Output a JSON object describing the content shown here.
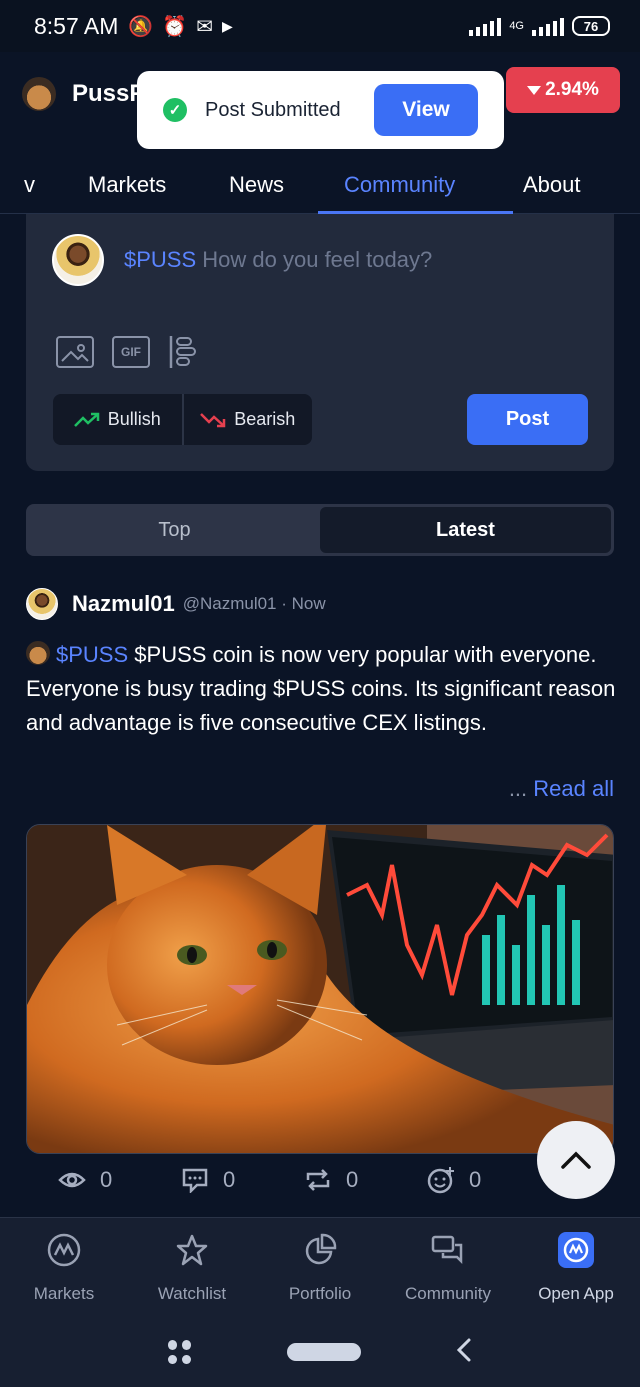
{
  "status_bar": {
    "time": "8:57 AM",
    "network": "4G",
    "battery": "76"
  },
  "header": {
    "brand": "PussF",
    "price_change": "2.94%"
  },
  "toast": {
    "message": "Post Submitted",
    "action": "View"
  },
  "tabs": [
    {
      "label": "v"
    },
    {
      "label": "Markets"
    },
    {
      "label": "News"
    },
    {
      "label": "Community"
    },
    {
      "label": "About"
    }
  ],
  "composer": {
    "ticker": "$PUSS",
    "placeholder": "How do you feel today?",
    "gif_label": "GIF",
    "bullish": "Bullish",
    "bearish": "Bearish",
    "post": "Post"
  },
  "feed_toggle": {
    "top": "Top",
    "latest": "Latest"
  },
  "post": {
    "author": "Nazmul01",
    "meta": "@Nazmul01 · Now",
    "ticker": "$PUSS",
    "text": "$PUSS coin is now very popular with everyone. Everyone is busy trading $PUSS coins. Its significant reason and advantage is five consecutive CEX listings.",
    "read_more_dots": "...",
    "read_more": "Read all",
    "views": "0",
    "comments": "0",
    "reposts": "0",
    "reactions": "0"
  },
  "bottom_nav": [
    {
      "label": "Markets"
    },
    {
      "label": "Watchlist"
    },
    {
      "label": "Portfolio"
    },
    {
      "label": "Community"
    },
    {
      "label": "Open App"
    }
  ],
  "colors": {
    "accent": "#3a6ef5",
    "bullish": "#1fbf63",
    "bearish": "#e5404f",
    "background": "#0b1426"
  }
}
